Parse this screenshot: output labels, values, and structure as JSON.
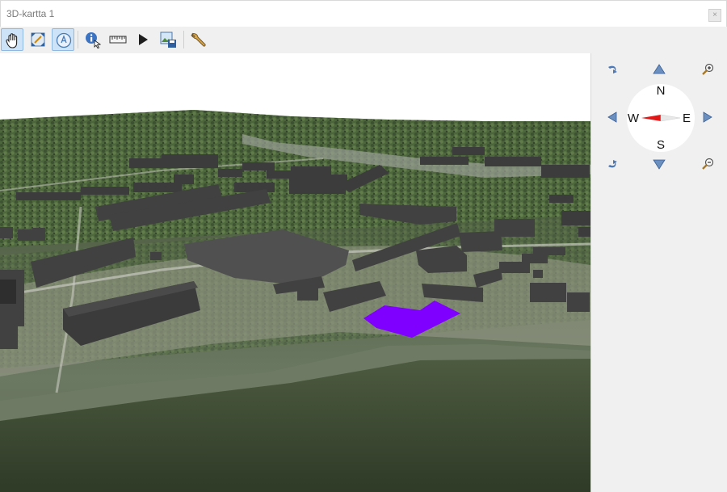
{
  "window": {
    "title": "3D-kartta 1",
    "close_glyph": "×"
  },
  "toolbar": {
    "tools": [
      {
        "icon": "pan-hand-icon",
        "active": true
      },
      {
        "icon": "zoom-full-extent-icon",
        "active": false
      },
      {
        "icon": "camera-rotate-icon",
        "active": true
      },
      {
        "icon": "identify-icon",
        "active": false
      },
      {
        "icon": "measure-line-icon",
        "active": false
      },
      {
        "icon": "play-animation-icon",
        "active": false
      },
      {
        "icon": "save-image-icon",
        "active": false
      },
      {
        "icon": "configure-wrench-icon",
        "active": false
      }
    ]
  },
  "compass": {
    "north": "N",
    "south": "S",
    "east": "E",
    "west": "W"
  },
  "colors": {
    "selected_building": "#8000ff",
    "building": "#3f3f3f",
    "terrain": "#5a6a44",
    "water": "#3f4a33"
  }
}
